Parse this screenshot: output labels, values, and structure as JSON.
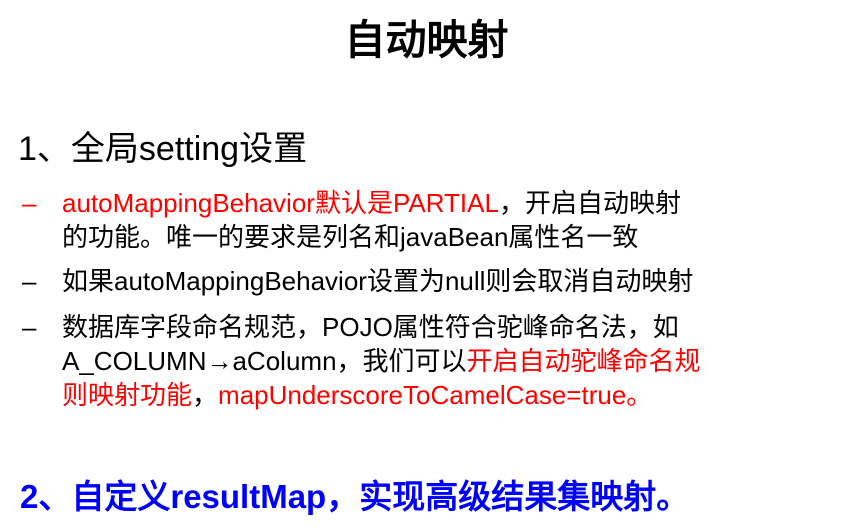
{
  "title": "自动映射",
  "section1": {
    "heading": "1、全局setting设置",
    "bullets": [
      {
        "dash": "–",
        "line1_red": "autoMappingBehavior默认是PARTIAL",
        "line1_black": "，开启自动映射",
        "line2": "的功能。唯一的要求是列名和javaBean属性名一致"
      },
      {
        "dash": "–",
        "line1": "如果autoMappingBehavior设置为null则会取消自动映射"
      },
      {
        "dash": "–",
        "line1": "数据库字段命名规范，POJO属性符合驼峰命名法，如",
        "line2_black": "A_COLUMN→aColumn，我们可以",
        "line2_red": "开启自动驼峰命名规",
        "line3_red_a": "则映射功能",
        "line3_black": "，",
        "line3_red_b": "mapUnderscoreToCamelCase=true。"
      }
    ]
  },
  "section2": {
    "heading": "2、自定义resultMap，实现高级结果集映射。"
  },
  "colors": {
    "text": "#000000",
    "highlight": "#ff0000",
    "section2": "#0000ff",
    "background": "#ffffff"
  }
}
